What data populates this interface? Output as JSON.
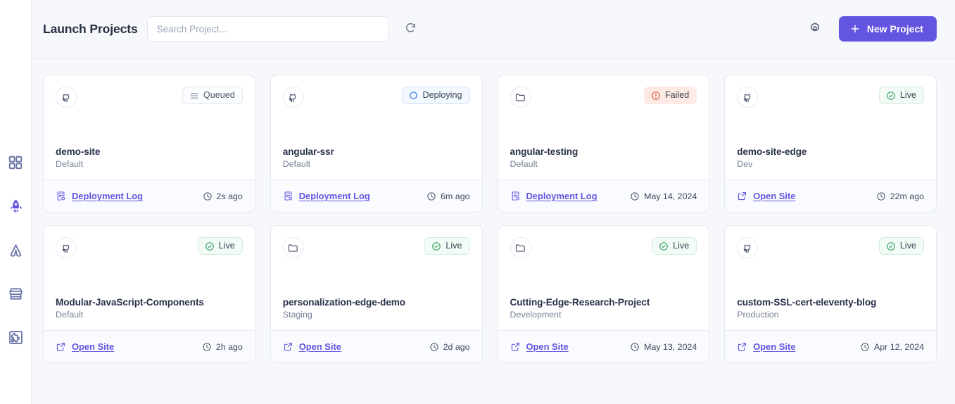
{
  "theme": {
    "accent": "#6355e0",
    "page_bg": "#f6f8fb",
    "card_bg": "#ffffff",
    "border": "#e4e8f1",
    "live_color": "#2f9e5e",
    "failed_color": "#d9553b",
    "deploying_color": "#2f7fe0",
    "queued_color": "#7b849b"
  },
  "sidebar": {
    "items": [
      {
        "name": "dashboard",
        "icon": "grid-icon",
        "active": false
      },
      {
        "name": "launch-projects",
        "icon": "rocket-icon",
        "active": true
      },
      {
        "name": "integrations",
        "icon": "arch-icon",
        "active": false
      },
      {
        "name": "marketplace",
        "icon": "store-icon",
        "active": false
      },
      {
        "name": "plugins",
        "icon": "puzzle-icon",
        "active": false
      }
    ]
  },
  "header": {
    "title": "Launch Projects",
    "search": {
      "placeholder": "Search Project...",
      "value": ""
    },
    "refresh_icon": "refresh-icon",
    "settings_icon": "gear-icon",
    "new_project": {
      "label": "New Project",
      "icon": "plus-icon",
      "color": "#6355e0"
    }
  },
  "projects": [
    {
      "name": "demo-site",
      "environment": "Default",
      "source_icon": "github-icon",
      "status": {
        "label": "Queued",
        "kind": "queued",
        "icon": "queue-list-icon"
      },
      "action": {
        "label": "Deployment Log",
        "icon": "deployment-log-icon"
      },
      "timestamp": "2s ago"
    },
    {
      "name": "angular-ssr",
      "environment": "Default",
      "source_icon": "github-icon",
      "status": {
        "label": "Deploying",
        "kind": "deploying",
        "icon": "circle-icon"
      },
      "action": {
        "label": "Deployment Log",
        "icon": "deployment-log-icon"
      },
      "timestamp": "6m ago"
    },
    {
      "name": "angular-testing",
      "environment": "Default",
      "source_icon": "folder-icon",
      "status": {
        "label": "Failed",
        "kind": "failed",
        "icon": "alert-circle-icon"
      },
      "action": {
        "label": "Deployment Log",
        "icon": "deployment-log-icon"
      },
      "timestamp": "May 14, 2024"
    },
    {
      "name": "demo-site-edge",
      "environment": "Dev",
      "source_icon": "github-icon",
      "status": {
        "label": "Live",
        "kind": "live",
        "icon": "check-circle-icon"
      },
      "action": {
        "label": "Open Site",
        "icon": "external-link-icon"
      },
      "timestamp": "22m ago"
    },
    {
      "name": "Modular-JavaScript-Components",
      "environment": "Default",
      "source_icon": "github-icon",
      "status": {
        "label": "Live",
        "kind": "live",
        "icon": "check-circle-icon"
      },
      "action": {
        "label": "Open Site",
        "icon": "external-link-icon"
      },
      "timestamp": "2h ago"
    },
    {
      "name": "personalization-edge-demo",
      "environment": "Staging",
      "source_icon": "folder-icon",
      "status": {
        "label": "Live",
        "kind": "live",
        "icon": "check-circle-icon"
      },
      "action": {
        "label": "Open Site",
        "icon": "external-link-icon"
      },
      "timestamp": "2d ago"
    },
    {
      "name": "Cutting-Edge-Research-Project",
      "environment": "Development",
      "source_icon": "folder-icon",
      "status": {
        "label": "Live",
        "kind": "live",
        "icon": "check-circle-icon"
      },
      "action": {
        "label": "Open Site",
        "icon": "external-link-icon"
      },
      "timestamp": "May 13, 2024"
    },
    {
      "name": "custom-SSL-cert-eleventy-blog",
      "environment": "Production",
      "source_icon": "github-icon",
      "status": {
        "label": "Live",
        "kind": "live",
        "icon": "check-circle-icon"
      },
      "action": {
        "label": "Open Site",
        "icon": "external-link-icon"
      },
      "timestamp": "Apr 12, 2024"
    }
  ]
}
